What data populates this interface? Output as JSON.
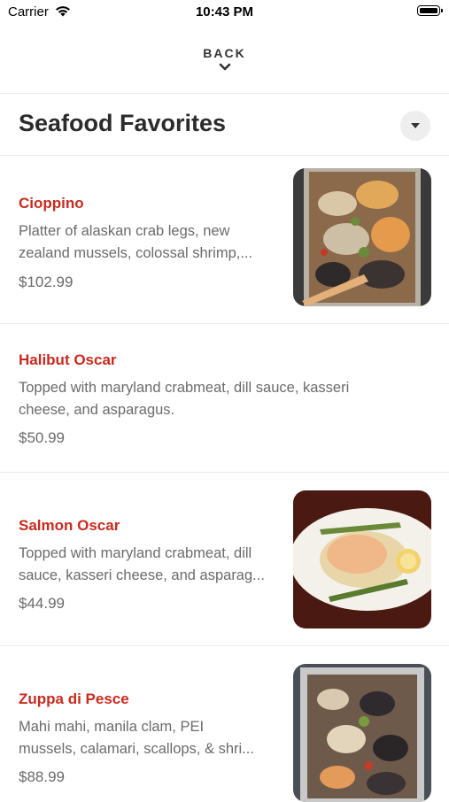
{
  "status": {
    "carrier": "Carrier",
    "time": "10:43 PM"
  },
  "nav": {
    "back_label": "BACK"
  },
  "section": {
    "title": "Seafood Favorites"
  },
  "items": [
    {
      "name": "Cioppino",
      "desc1": "Platter of alaskan crab legs, new",
      "desc2": "zealand mussels, colossal shrimp,...",
      "price": "$102.99"
    },
    {
      "name": "Halibut Oscar",
      "desc1": "Topped with maryland crabmeat, dill sauce, kasseri",
      "desc2": "cheese, and asparagus.",
      "price": "$50.99"
    },
    {
      "name": "Salmon Oscar",
      "desc1": "Topped with maryland crabmeat, dill",
      "desc2": "sauce, kasseri cheese, and asparag...",
      "price": "$44.99"
    },
    {
      "name": "Zuppa di Pesce",
      "desc1": "Mahi mahi, manila clam, PEI",
      "desc2": "mussels, calamari, scallops, & shri...",
      "price": "$88.99"
    }
  ]
}
